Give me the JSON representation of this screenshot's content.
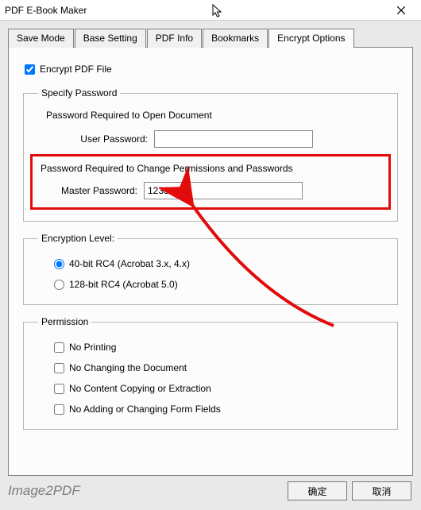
{
  "window": {
    "title": "PDF E-Book Maker"
  },
  "tabs": {
    "save_mode": "Save Mode",
    "base_setting": "Base Setting",
    "pdf_info": "PDF Info",
    "bookmarks": "Bookmarks",
    "encrypt_options": "Encrypt Options"
  },
  "encrypt": {
    "encrypt_pdf_label": "Encrypt PDF File",
    "specify_password_group": "Specify Password",
    "open_doc_label": "Password Required to Open Document",
    "user_password_label": "User Password:",
    "user_password_value": "",
    "change_perm_label": "Password Required to Change Permissions and Passwords",
    "master_password_label": "Master Password:",
    "master_password_value": "123333",
    "encryption_level_group": "Encryption Level:",
    "level_40": "40-bit RC4 (Acrobat 3.x, 4.x)",
    "level_128": "128-bit RC4 (Acrobat 5.0)",
    "permission_group": "Permission",
    "perm_no_print": "No Printing",
    "perm_no_change_doc": "No Changing the Document",
    "perm_no_copy": "No Content Copying or Extraction",
    "perm_no_forms": "No Adding or Changing Form Fields"
  },
  "footer": {
    "brand": "Image2PDF",
    "ok": "确定",
    "cancel": "取消"
  }
}
